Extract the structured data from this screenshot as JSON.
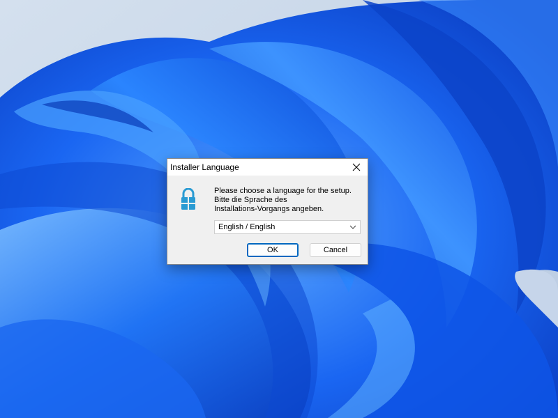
{
  "dialog": {
    "title": "Installer Language",
    "message": "Please choose a language for the setup.\nBitte die Sprache des\nInstallations-Vorgangs angeben.",
    "language_select": {
      "value": "English / English"
    },
    "ok_label": "OK",
    "cancel_label": "Cancel",
    "icons": {
      "app": "lock-icon",
      "close": "close-icon",
      "dropdown": "chevron-down-icon"
    }
  },
  "colors": {
    "wallpaper_light": "#c8d7ea",
    "wallpaper_blue": "#0a55e8",
    "accent": "#0067c0",
    "lock_icon": "#2a9bd3"
  }
}
